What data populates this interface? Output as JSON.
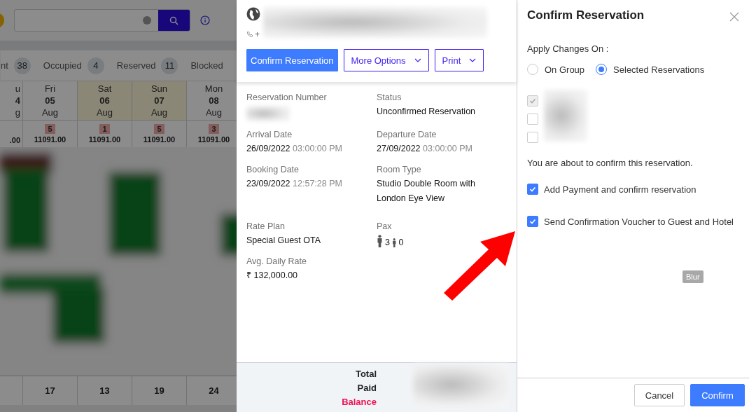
{
  "background": {
    "stats": [
      {
        "label": "nt",
        "count": "38"
      },
      {
        "label": "Occupied",
        "count": "4"
      },
      {
        "label": "Reserved",
        "count": "11"
      },
      {
        "label": "Blocked"
      }
    ],
    "days": [
      {
        "day": "u",
        "date": "4",
        "month": "g",
        "weekend": false
      },
      {
        "day": "Fri",
        "date": "05",
        "month": "Aug",
        "weekend": false
      },
      {
        "day": "Sat",
        "date": "06",
        "month": "Aug",
        "weekend": true
      },
      {
        "day": "Sun",
        "date": "07",
        "month": "Aug",
        "weekend": true
      },
      {
        "day": "Mon",
        "date": "08",
        "month": "Aug",
        "weekend": false
      }
    ],
    "availability": [
      {
        "price": ".00"
      },
      {
        "count": "5",
        "price": "11091.00"
      },
      {
        "count": "1",
        "price": "11091.00"
      },
      {
        "count": "5",
        "price": "11091.00"
      },
      {
        "count": "3",
        "price": "11091.00"
      }
    ],
    "totals": [
      "17",
      "13",
      "19",
      "24"
    ]
  },
  "reservation": {
    "phone_prefix": "+",
    "actions": [
      {
        "label": "Confirm Reservation",
        "kind": "primary"
      },
      {
        "label": "More Options",
        "kind": "dropdown"
      },
      {
        "label": "Print",
        "kind": "dropdown"
      }
    ],
    "fields": [
      {
        "label": "Reservation Number",
        "kind": "redacted"
      },
      {
        "label": "Status",
        "value": "Unconfirmed Reservation"
      },
      {
        "label": "Arrival Date",
        "value": "26/09/2022",
        "time": "03:00:00 PM"
      },
      {
        "label": "Departure Date",
        "value": "27/09/2022",
        "time": "03:00:00 PM"
      },
      {
        "label": "Booking Date",
        "value": "23/09/2022",
        "time": "12:57:28 PM"
      },
      {
        "label": "Room Type",
        "value": "Studio Double Room with London Eye View"
      },
      {
        "label": "Rate Plan",
        "value": "Special Guest OTA"
      },
      {
        "label": "Pax",
        "kind": "pax",
        "adults": "3",
        "children": "0"
      },
      {
        "label": "Avg. Daily Rate",
        "value": "₹ 132,000.00"
      }
    ],
    "summary": [
      {
        "label": "Total",
        "kind": "normal"
      },
      {
        "label": "Paid",
        "kind": "normal"
      },
      {
        "label": "Balance",
        "kind": "due"
      }
    ]
  },
  "dialog": {
    "title": "Confirm Reservation",
    "apply_label": "Apply Changes On :",
    "scope": [
      {
        "label": "On Group",
        "selected": false
      },
      {
        "label": "Selected Reservations",
        "selected": true
      }
    ],
    "reservations": [
      {
        "checked": true,
        "disabled": true
      },
      {
        "checked": false,
        "disabled": false
      },
      {
        "checked": false,
        "disabled": false
      }
    ],
    "message": "You are about to confirm this reservation.",
    "options": [
      {
        "label": "Add Payment and confirm reservation",
        "checked": true
      },
      {
        "label": "Send Confirmation Voucher to Guest and Hotel",
        "checked": true
      }
    ],
    "tag": "Blur",
    "buttons": [
      {
        "label": "Cancel",
        "kind": "secondary"
      },
      {
        "label": "Confirm",
        "kind": "primary"
      }
    ]
  }
}
